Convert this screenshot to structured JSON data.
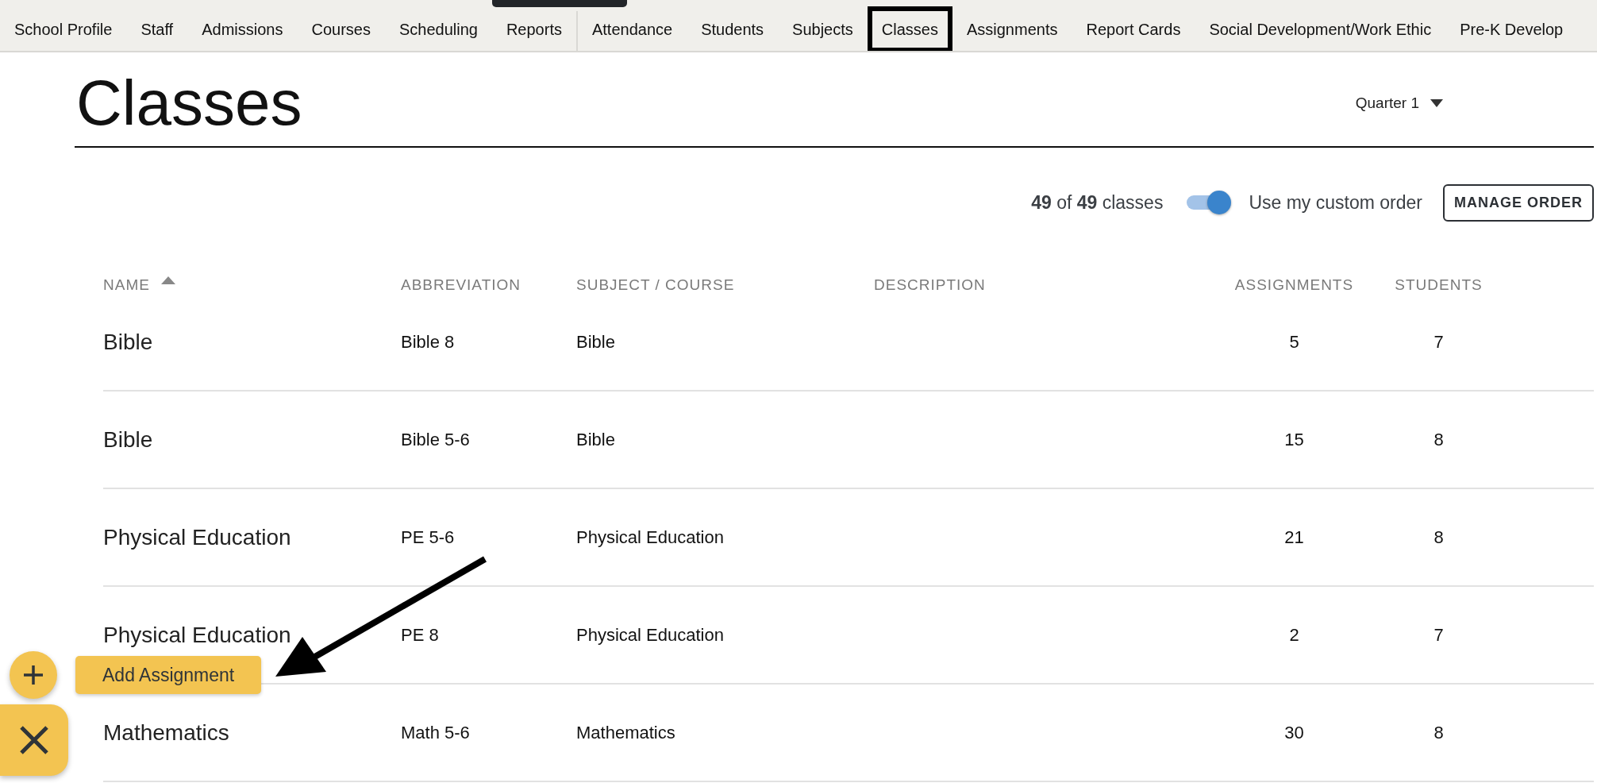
{
  "nav": {
    "items": [
      {
        "label": "School Profile",
        "selected": false
      },
      {
        "label": "Staff",
        "selected": false
      },
      {
        "label": "Admissions",
        "selected": false
      },
      {
        "label": "Courses",
        "selected": false
      },
      {
        "label": "Scheduling",
        "selected": false
      },
      {
        "label": "Reports",
        "selected": false,
        "separator_after": true
      },
      {
        "label": "Attendance",
        "selected": false
      },
      {
        "label": "Students",
        "selected": false
      },
      {
        "label": "Subjects",
        "selected": false
      },
      {
        "label": "Classes",
        "selected": true
      },
      {
        "label": "Assignments",
        "selected": false
      },
      {
        "label": "Report Cards",
        "selected": false
      },
      {
        "label": "Social Development/Work Ethic",
        "selected": false
      },
      {
        "label": "Pre-K Develop",
        "selected": false
      }
    ]
  },
  "page": {
    "title": "Classes",
    "term_selector": "Quarter 1"
  },
  "toolbar": {
    "count": "**49** of **49** classes",
    "custom_order": {
      "label": "Use my custom order",
      "on": true
    },
    "manage_button": "MANAGE ORDER"
  },
  "table": {
    "columns": [
      {
        "label": "NAME",
        "sorted_ascending": true
      },
      {
        "label": "ABBREVIATION"
      },
      {
        "label": "SUBJECT / COURSE"
      },
      {
        "label": "DESCRIPTION"
      },
      {
        "label": "ASSIGNMENTS"
      },
      {
        "label": "STUDENTS"
      }
    ],
    "rows": [
      [
        "Bible",
        "Bible 8",
        "Bible",
        "",
        "5",
        "7"
      ],
      [
        "Bible",
        "Bible 5-6",
        "Bible",
        "",
        "15",
        "8"
      ],
      [
        "Physical Education",
        "PE 5-6",
        "Physical Education",
        "",
        "21",
        "8"
      ],
      [
        "Physical Education",
        "PE 8",
        "Physical Education",
        "",
        "2",
        "7"
      ],
      [
        "Mathematics",
        "Math 5-6",
        "Mathematics",
        "",
        "30",
        "8"
      ]
    ]
  },
  "fab": {
    "action_label": "Add Assignment"
  }
}
